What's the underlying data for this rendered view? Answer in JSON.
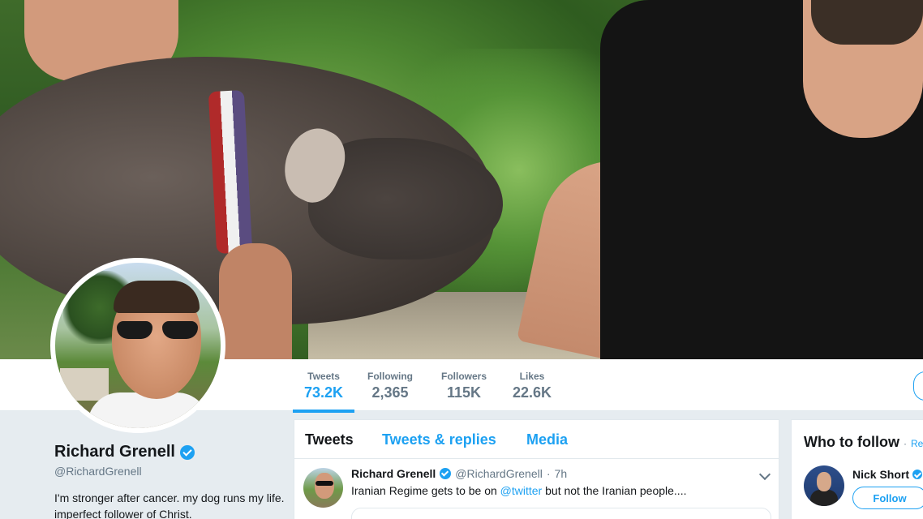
{
  "profile": {
    "name": "Richard Grenell",
    "handle": "@RichardGrenell",
    "bio": "I'm stronger after cancer. my dog runs my life. imperfect follower of Christ."
  },
  "stats": [
    {
      "label": "Tweets",
      "value": "73.2K",
      "active": true
    },
    {
      "label": "Following",
      "value": "2,365",
      "active": false
    },
    {
      "label": "Followers",
      "value": "115K",
      "active": false
    },
    {
      "label": "Likes",
      "value": "22.6K",
      "active": false
    }
  ],
  "timeline": {
    "tabs": [
      "Tweets",
      "Tweets & replies",
      "Media"
    ],
    "tweet": {
      "name": "Richard Grenell",
      "handle": "@RichardGrenell",
      "dot": "·",
      "time": "7h",
      "text_before": "Iranian Regime gets to be on ",
      "mention": "@twitter",
      "text_after": " but not the Iranian people...."
    }
  },
  "who_to_follow": {
    "title": "Who to follow",
    "dot": "·",
    "refresh": "Re",
    "suggestion": {
      "name": "Nick Short",
      "button": "Follow"
    }
  },
  "colors": {
    "accent": "#1da1f2",
    "text": "#14171a",
    "muted": "#657786",
    "background": "#e6ecf0"
  }
}
